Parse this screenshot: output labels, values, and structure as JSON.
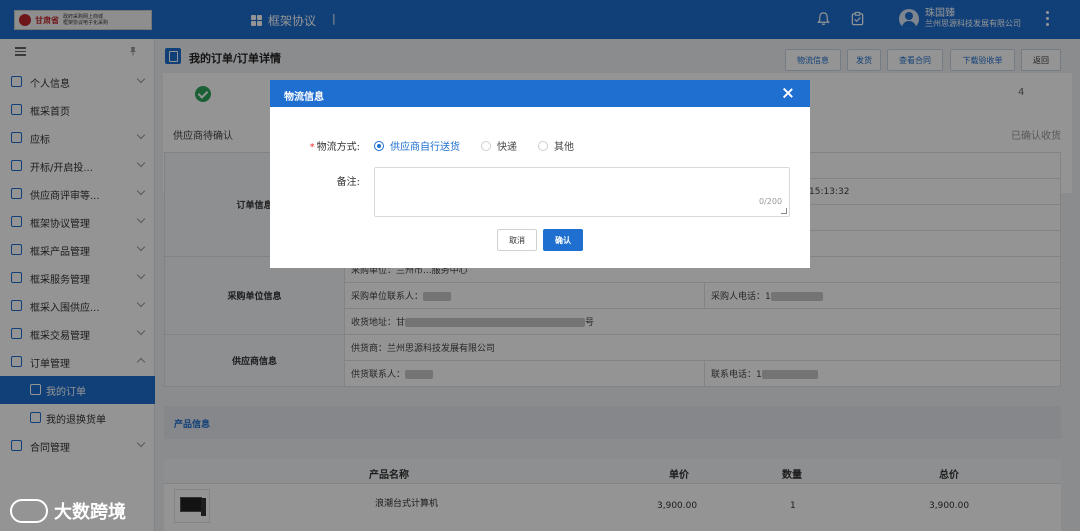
{
  "header": {
    "logo_text": "甘肃省",
    "logo_sub1": "政府采购网上商城",
    "logo_sub2": "框架协议电子化采购",
    "app_title": "框架协议",
    "separator": "|",
    "user_name": "珠国臻",
    "user_org": "兰州思源科技发展有限公司",
    "icons": [
      "bell-icon",
      "clipboard-check-icon",
      "user-avatar",
      "more-vertical-icon"
    ],
    "accent_color": "#1e6fd0"
  },
  "sidebar": {
    "items": [
      {
        "label": "个人信息",
        "icon": "user-card-icon",
        "expandable": true,
        "expanded": false
      },
      {
        "label": "框采首页",
        "icon": "home-icon",
        "expandable": false
      },
      {
        "label": "应标",
        "icon": "bid-icon",
        "expandable": true,
        "expanded": false
      },
      {
        "label": "开标/开启投...",
        "icon": "open-bid-icon",
        "expandable": true,
        "expanded": false
      },
      {
        "label": "供应商评审等...",
        "icon": "review-icon",
        "expandable": true,
        "expanded": false
      },
      {
        "label": "框架协议管理",
        "icon": "agreement-icon",
        "expandable": true,
        "expanded": false
      },
      {
        "label": "框采产品管理",
        "icon": "product-icon",
        "expandable": true,
        "expanded": false
      },
      {
        "label": "框采服务管理",
        "icon": "service-icon",
        "expandable": true,
        "expanded": false
      },
      {
        "label": "框采入围供应...",
        "icon": "supplier-icon",
        "expandable": true,
        "expanded": false
      },
      {
        "label": "框采交易管理",
        "icon": "trade-icon",
        "expandable": true,
        "expanded": false
      },
      {
        "label": "订单管理",
        "icon": "order-icon",
        "expandable": true,
        "expanded": true
      },
      {
        "label": "我的订单",
        "icon": "my-order-icon",
        "sub": true,
        "active": true
      },
      {
        "label": "我的退换货单",
        "icon": "return-icon",
        "sub": true
      },
      {
        "label": "合同管理",
        "icon": "contract-icon",
        "expandable": true,
        "expanded": false
      }
    ]
  },
  "page": {
    "title": "我的订单/订单详情",
    "buttons": [
      "物流信息",
      "发货",
      "查看合同",
      "下载验收单",
      "返回"
    ]
  },
  "steps": {
    "last_number": "4",
    "left_label": "供应商待确认",
    "right_label": "已确认收货"
  },
  "info": {
    "order_head": "订单信息",
    "order_time": "15:13:32",
    "buyer_head": "采购单位信息",
    "buyer_unit_partial": "采购单位：兰州市...服务中心",
    "buyer_contact_label": "采购单位联系人：",
    "buyer_phone_label": "采购人电话：1",
    "address_label": "收货地址：甘",
    "address_tail": "号",
    "supplier_head": "供应商信息",
    "supplier_label": "供货商：兰州思源科技发展有限公司",
    "supplier_contact_label": "供货联系人：",
    "supplier_phone_label": "联系电话：1"
  },
  "product_section": {
    "title": "产品信息",
    "columns": [
      "产品名称",
      "单价",
      "数量",
      "总价"
    ],
    "rows": [
      {
        "name": "浪潮台式计算机",
        "price": "3,900.00",
        "qty": "1",
        "total": "3,900.00"
      }
    ]
  },
  "modal": {
    "title": "物流信息",
    "shipping_label": "物流方式:",
    "required_mark": "*",
    "options": [
      {
        "label": "供应商自行送货",
        "selected": true
      },
      {
        "label": "快递",
        "selected": false
      },
      {
        "label": "其他",
        "selected": false
      }
    ],
    "remark_label": "备注:",
    "remark_value": "",
    "remark_counter": "0/200",
    "cancel_label": "取消",
    "confirm_label": "确认"
  },
  "watermark": {
    "text": "大数跨境"
  }
}
